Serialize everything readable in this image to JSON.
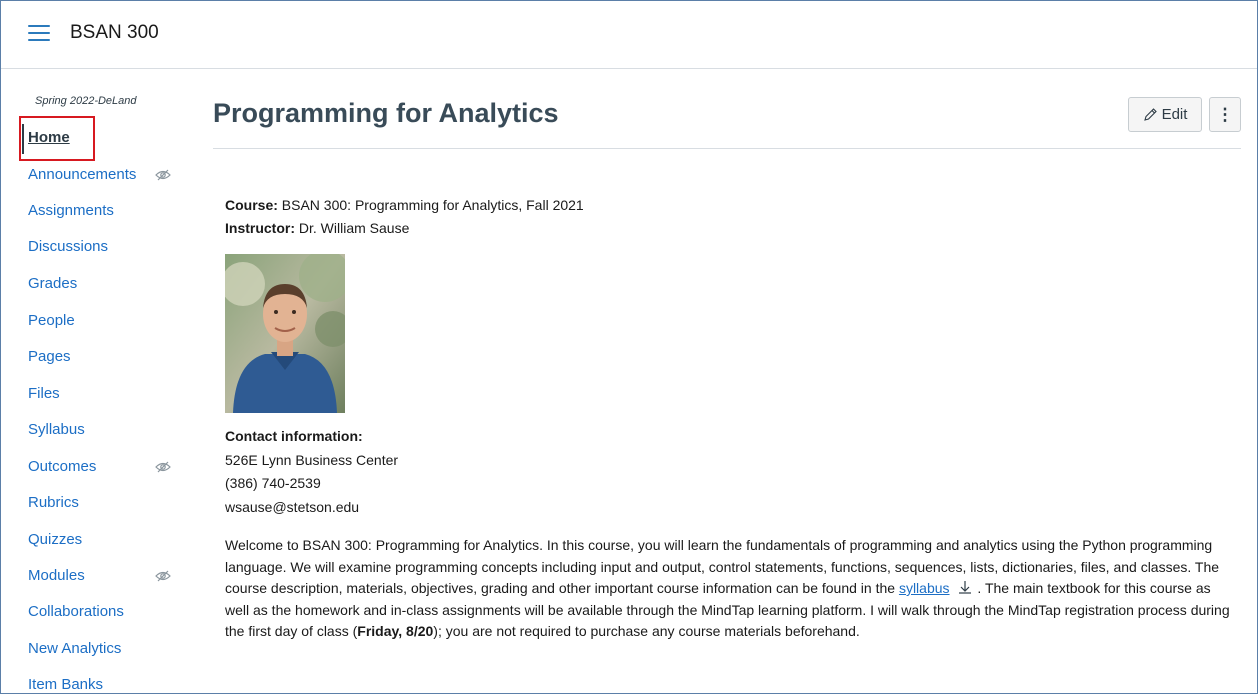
{
  "header": {
    "course_code": "BSAN 300"
  },
  "sidebar": {
    "term": "Spring 2022-DeLand",
    "items": [
      {
        "label": "Home",
        "active": true,
        "hidden": false
      },
      {
        "label": "Announcements",
        "active": false,
        "hidden": true
      },
      {
        "label": "Assignments",
        "active": false,
        "hidden": false
      },
      {
        "label": "Discussions",
        "active": false,
        "hidden": false
      },
      {
        "label": "Grades",
        "active": false,
        "hidden": false
      },
      {
        "label": "People",
        "active": false,
        "hidden": false
      },
      {
        "label": "Pages",
        "active": false,
        "hidden": false
      },
      {
        "label": "Files",
        "active": false,
        "hidden": false
      },
      {
        "label": "Syllabus",
        "active": false,
        "hidden": false
      },
      {
        "label": "Outcomes",
        "active": false,
        "hidden": true
      },
      {
        "label": "Rubrics",
        "active": false,
        "hidden": false
      },
      {
        "label": "Quizzes",
        "active": false,
        "hidden": false
      },
      {
        "label": "Modules",
        "active": false,
        "hidden": true
      },
      {
        "label": "Collaborations",
        "active": false,
        "hidden": false
      },
      {
        "label": "New Analytics",
        "active": false,
        "hidden": false
      },
      {
        "label": "Item Banks",
        "active": false,
        "hidden": false
      }
    ]
  },
  "main": {
    "title": "Programming for Analytics",
    "edit_label": "Edit",
    "more_label": "⋮",
    "course_label": "Course:",
    "course_value": " BSAN 300: Programming for Analytics, Fall 2021",
    "instructor_label": "Instructor:",
    "instructor_value": " Dr. William Sause",
    "contact_heading": "Contact information:",
    "contact_address": "526E Lynn Business Center",
    "contact_phone": "(386) 740-2539",
    "contact_email": "wsause@stetson.edu",
    "welcome_part1": "Welcome to BSAN 300: Programming for Analytics. In this course, you will learn the fundamentals of programming and analytics using the Python programming language.  We will examine programming concepts including input and output, control statements, functions, sequences, lists, dictionaries, files, and classes.  The course description, materials, objectives, grading and other important course information can be found in the ",
    "syllabus_link": "syllabus",
    "welcome_part2": " .  The main textbook for this course as well as the homework and in-class assignments will be available through the MindTap learning platform. I will walk through the MindTap registration process during the first day of class (",
    "welcome_bold": "Friday, 8/20",
    "welcome_part3": "); you are not required to purchase any course materials beforehand."
  },
  "colors": {
    "link": "#1c6ec5",
    "highlight": "#d71920",
    "hamburger": "#2b7abc"
  }
}
